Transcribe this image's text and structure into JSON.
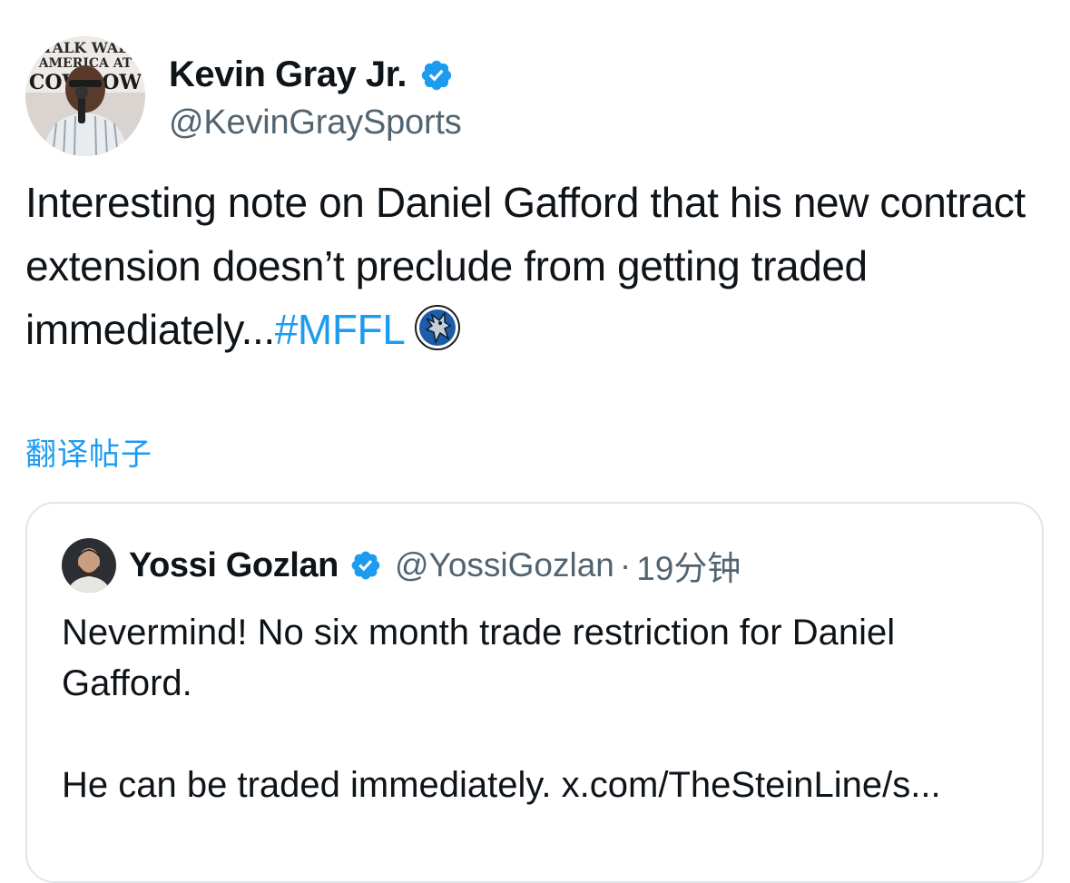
{
  "tweet": {
    "author": {
      "display_name": "Kevin Gray Jr.",
      "handle": "@KevinGraySports",
      "verified": true,
      "avatar_banner_text": "TALK WAL AMERICA AT COWBOW"
    },
    "text_main": "Interesting note on Daniel Gafford that his new contract extension doesn’t preclude from getting traded immediately...",
    "hashtag": "#MFFL",
    "emoji_icon": "dallas-mavericks-logo-icon",
    "translate_label": "翻译帖子"
  },
  "quoted_tweet": {
    "author": {
      "display_name": "Yossi Gozlan",
      "handle": "@YossiGozlan",
      "verified": true
    },
    "separator": "·",
    "timestamp": "19分钟",
    "paragraph_1": "Nevermind! No six month trade restriction for Daniel Gafford.",
    "paragraph_2": "He can be traded immediately. x.com/TheSteinLine/s..."
  },
  "colors": {
    "link_blue": "#1d9bf0",
    "secondary_text": "#536471",
    "primary_text": "#0f1419",
    "border": "#e1e5e9"
  }
}
